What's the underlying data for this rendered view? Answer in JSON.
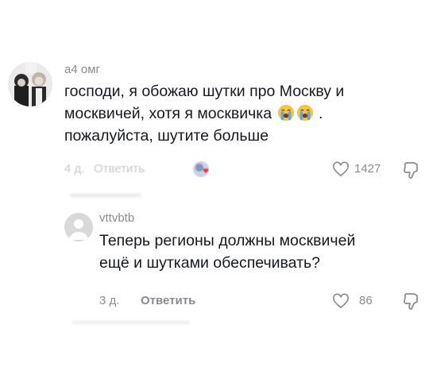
{
  "comments": [
    {
      "username": "а4 омг",
      "text_line1": "господи, я обожаю шутки про Москву и",
      "text_line2": "москвичей, хотя я москвичка",
      "text_line2_tail": ".",
      "text_line3": "пожалуйста, шутите больше",
      "time": "4 д.",
      "reply_label": "Ответить",
      "likes": "1427",
      "avatar_icon": "user-photo-avatar",
      "emoji_icon": "loudly-crying-face-emoji"
    },
    {
      "username": "vttvbtb",
      "text_line1": "Теперь регионы должны москвичей",
      "text_line2": "ещё и шутками обеспечивать?",
      "time": "3 д.",
      "reply_label": "Ответить",
      "likes": "86",
      "avatar_icon": "default-avatar-icon"
    }
  ]
}
